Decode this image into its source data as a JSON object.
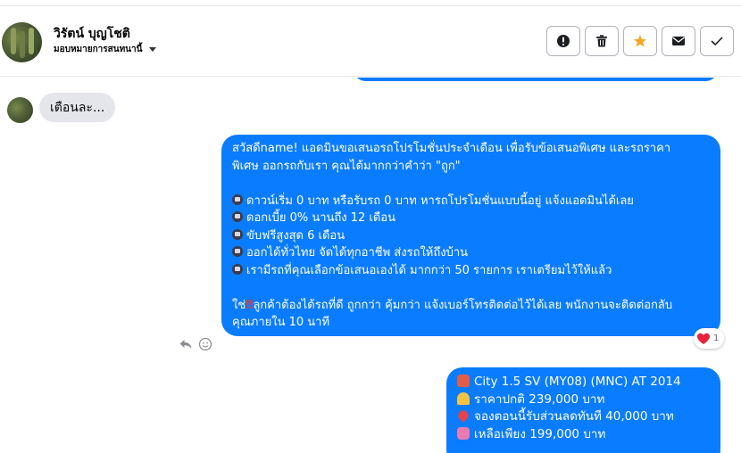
{
  "header": {
    "contact_name": "วิรัตน์ บุญโชติ",
    "assign_label": "มอบหมายการสนทนานี้",
    "actions": [
      {
        "name": "mark-spam-button",
        "icon": "exclamation-circle-icon"
      },
      {
        "name": "delete-button",
        "icon": "trash-icon"
      },
      {
        "name": "star-button",
        "icon": "star-icon"
      },
      {
        "name": "mark-unread-button",
        "icon": "envelope-icon"
      },
      {
        "name": "mark-done-button",
        "icon": "check-icon"
      }
    ]
  },
  "messages": {
    "incoming_text": "เตือนละ...",
    "outgoing_1": {
      "intro_line1": "สวัสดีname! แอดมินขอเสนอรถโปรโมชั่นประจำเดือน เพื่อรับข้อเสนอพิเศษ และรถราคา",
      "intro_line2": "พิเศษ ออกรถกับเรา คุณได้มากกว่าคำว่า \"ถูก\"",
      "bullets": [
        "ดาวน์เริ่ม 0 บาท หรือรับรถ 0 บาท หารถโปรโมชั่นแบบนี้อยู่ แจ้งแอดมินได้เลย",
        "ดอกเบี้ย 0% นานถึง 12 เดือน",
        "ขับฟรีสูงสุด 6 เดือน",
        "ออกได้ทั่วไทย จัดได้ทุกอาชีพ ส่งรถให้ถึงบ้าน",
        "เรามีรถที่คุณเลือกข้อเสนอเองได้ มากกว่า 50 รายการ เราเตรียมไว้ให้แล้ว"
      ],
      "closing_prefix": "ใช่",
      "closing_mark": "‼",
      "closing_line1": "ลูกค้าต้องได้รถที่ดี ถูกกว่า คุ้มกว่า แจ้งเบอร์โทรติดต่อไว้ได้เลย พนักงานจะติดต่อกลับ",
      "closing_line2": "คุณภายใน 10 นาที",
      "reaction_count": "1"
    },
    "outgoing_2": {
      "lines": [
        {
          "icon": "car-icon",
          "text": "City 1.5 SV (MY08) (MNC) AT 2014"
        },
        {
          "icon": "bell-icon",
          "text": "ราคาปกติ  239,000 บาท"
        },
        {
          "icon": "pin-icon",
          "text": "จองตอนนี้รับส่วนลดทันที 40,000 บาท"
        },
        {
          "icon": "ribbon-icon",
          "text": "เหลือเพียง 199,000 บาท"
        }
      ]
    }
  },
  "colors": {
    "outgoing_bubble": "#0a7cff",
    "incoming_bubble": "#e4e6eb",
    "star": "#f5a623"
  }
}
